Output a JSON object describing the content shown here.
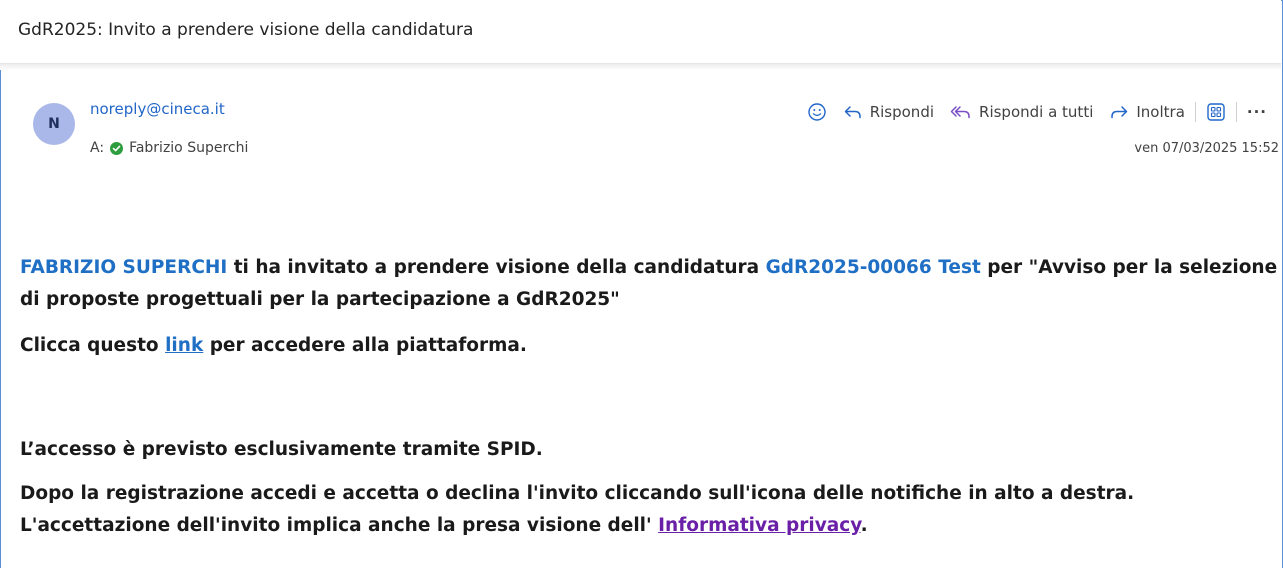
{
  "email": {
    "subject": "GdR2025: Invito a prendere visione della candidatura",
    "avatar_initial": "N",
    "sender": "noreply@cineca.it",
    "to_label": "A:",
    "recipient": "Fabrizio Superchi",
    "datetime": "ven 07/03/2025 15:52"
  },
  "actions": {
    "reply": "Rispondi",
    "reply_all": "Rispondi a tutti",
    "forward": "Inoltra",
    "more": "···"
  },
  "body": {
    "p1_name": "FABRIZIO SUPERCHI",
    "p1_text1": " ti ha invitato a prendere visione della candidatura ",
    "p1_code": "GdR2025-00066 Test",
    "p1_text2": " per \"Avviso per la selezione di proposte progettuali per la partecipazione a GdR2025\"",
    "p2_before": "Clicca questo ",
    "p2_link": "link",
    "p2_after": " per accedere alla piattaforma.",
    "p3": "L’accesso è previsto esclusivamente tramite SPID.",
    "p4_line1": "Dopo la registrazione accedi e accetta o declina l'invito cliccando sull'icona delle notifiche in alto a destra.",
    "p4_line2_before": "L'accettazione dell'invito implica anche la presa visione dell' ",
    "p4_link": "Informativa privacy",
    "p4_after": "."
  },
  "colors": {
    "accent_blue": "#1f6fc5",
    "privacy_link": "#6a1fa7",
    "presence_green": "#2e9d3e",
    "avatar_bg": "#a9b8e8"
  },
  "icons": [
    "emoji-icon",
    "reply-icon",
    "reply-all-icon",
    "forward-icon",
    "apps-icon",
    "more-icon",
    "available-check-icon"
  ]
}
